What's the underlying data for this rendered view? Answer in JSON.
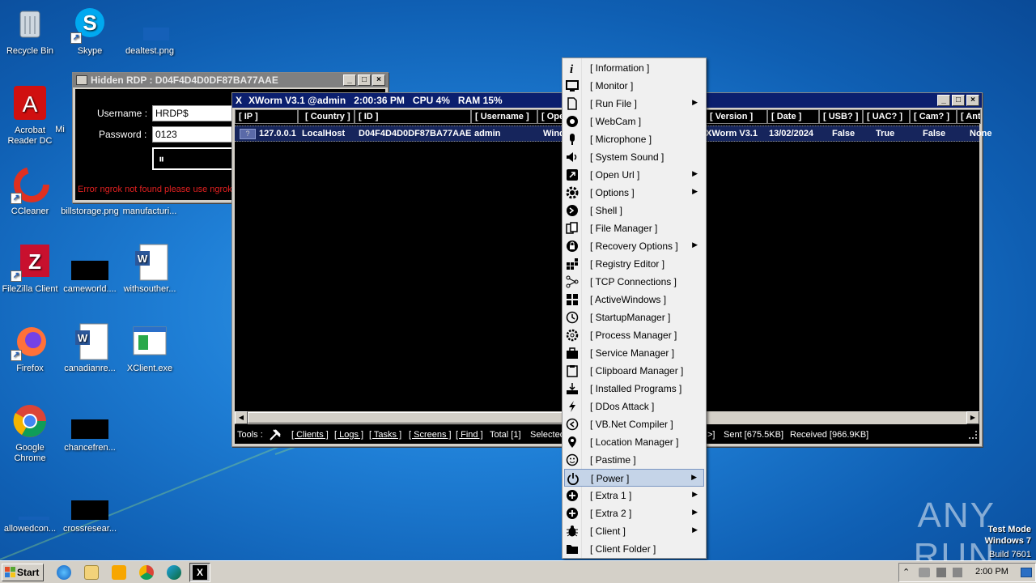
{
  "desktop_icons": [
    {
      "name": "recycle-bin-icon",
      "label": "Recycle Bin"
    },
    {
      "name": "skype-icon",
      "label": "Skype"
    },
    {
      "name": "dealtest-icon",
      "label": "dealtest.png"
    },
    {
      "name": "acrobat-icon",
      "label": "Acrobat Reader DC"
    },
    {
      "name": "mi-icon",
      "label": "Mi"
    },
    {
      "name": "ccleaner-icon",
      "label": "CCleaner"
    },
    {
      "name": "billstorage-icon",
      "label": "billstorage.png"
    },
    {
      "name": "manufacturi-icon",
      "label": "manufacturi..."
    },
    {
      "name": "filezilla-icon",
      "label": "FileZilla Client"
    },
    {
      "name": "cameworld-icon",
      "label": "cameworld...."
    },
    {
      "name": "withsouther-icon",
      "label": "withsouther..."
    },
    {
      "name": "firefox-icon",
      "label": "Firefox"
    },
    {
      "name": "canadianre-icon",
      "label": "canadianre..."
    },
    {
      "name": "xclient-icon",
      "label": "XClient.exe"
    },
    {
      "name": "chrome-icon",
      "label": "Google Chrome"
    },
    {
      "name": "chancefren-icon",
      "label": "chancefren..."
    },
    {
      "name": "allowedcon-icon",
      "label": "allowedcon..."
    },
    {
      "name": "crossresear-icon",
      "label": "crossresear..."
    }
  ],
  "rdp": {
    "title": "Hidden RDP : D04F4D4D0DF87BA77AAE",
    "username_label": "Username :",
    "username_value": "HRDP$",
    "password_label": "Password :",
    "password_value": "0123",
    "pause_symbol": "⏸",
    "error": "Error ngrok not found please use ngrok"
  },
  "xworm": {
    "title": "XWorm V3.1 @admin",
    "time": "2:00:36 PM",
    "cpu": "CPU 4%",
    "ram": "RAM 15%",
    "columns": [
      "[ IP ]",
      "[ Country ]",
      "[ ID ]",
      "[ Username ]",
      "[ Ope",
      "[ Version ]",
      "[ Date ]",
      "[ USB? ]",
      "[ UAC? ]",
      "[ Cam? ]",
      "[ Anti"
    ],
    "row": {
      "ip": "127.0.0.1",
      "country": "LocalHost",
      "id": "D04F4D4D0DF87BA77AAE",
      "username": "admin",
      "os": "Wind",
      "version": "XWorm V3.1",
      "date": "13/02/2024",
      "usb": "False",
      "uac": "True",
      "cam": "False",
      "anti": "None"
    },
    "status": {
      "tools": "Tools :",
      "clients": "[ Clients ]",
      "logs": "[ Logs ]",
      "tasks": "[ Tasks ]",
      "screens": "[ Screens ]",
      "find": "[ Find ]",
      "total": "Total [1]",
      "selected": "Selected",
      "tail": ">]",
      "sent": "Sent [675.5KB]",
      "received": "Received [966.9KB]"
    }
  },
  "menu": [
    {
      "label": "[ Information ]",
      "icon": "info-icon",
      "sub": false
    },
    {
      "label": "[ Monitor ]",
      "icon": "monitor-icon",
      "sub": false
    },
    {
      "label": "[ Run File ]",
      "icon": "file-icon",
      "sub": true
    },
    {
      "label": "[ WebCam ]",
      "icon": "webcam-icon",
      "sub": false
    },
    {
      "label": "[ Microphone ]",
      "icon": "microphone-icon",
      "sub": false
    },
    {
      "label": "[ System Sound ]",
      "icon": "speaker-icon",
      "sub": false
    },
    {
      "label": "[ Open Url ]",
      "icon": "link-icon",
      "sub": true
    },
    {
      "label": "[ Options ]",
      "icon": "gear-icon",
      "sub": true
    },
    {
      "label": "[ Shell ]",
      "icon": "shell-icon",
      "sub": false
    },
    {
      "label": "[ File Manager ]",
      "icon": "files-icon",
      "sub": false
    },
    {
      "label": "[ Recovery Options ]",
      "icon": "recovery-icon",
      "sub": true
    },
    {
      "label": "[ Registry Editor ]",
      "icon": "registry-icon",
      "sub": false
    },
    {
      "label": "[ TCP Connections ]",
      "icon": "network-icon",
      "sub": false
    },
    {
      "label": "[ ActiveWindows ]",
      "icon": "windows-icon",
      "sub": false
    },
    {
      "label": "[ StartupManager ]",
      "icon": "clock-icon",
      "sub": false
    },
    {
      "label": "[ Process Manager ]",
      "icon": "cog-icon",
      "sub": false
    },
    {
      "label": "[ Service Manager ]",
      "icon": "service-icon",
      "sub": false
    },
    {
      "label": "[ Clipboard Manager ]",
      "icon": "clipboard-icon",
      "sub": false
    },
    {
      "label": "[ Installed Programs ]",
      "icon": "download-icon",
      "sub": false
    },
    {
      "label": "[ DDos Attack ]",
      "icon": "lightning-icon",
      "sub": false
    },
    {
      "label": "[ VB.Net Compiler ]",
      "icon": "compiler-icon",
      "sub": false
    },
    {
      "label": "[ Location Manager ]",
      "icon": "location-icon",
      "sub": false
    },
    {
      "label": "[ Pastime ]",
      "icon": "smiley-icon",
      "sub": false
    },
    {
      "label": "[ Power ]",
      "icon": "power-icon",
      "sub": true,
      "highlight": true
    },
    {
      "label": "[ Extra 1 ]",
      "icon": "plus-icon",
      "sub": true
    },
    {
      "label": "[ Extra 2 ]",
      "icon": "plus-icon",
      "sub": true
    },
    {
      "label": "[ Client ]",
      "icon": "bug-icon",
      "sub": true
    },
    {
      "label": "[ Client Folder ]",
      "icon": "folder-icon",
      "sub": false
    }
  ],
  "taskbar": {
    "start": "Start",
    "clock": "2:00 PM"
  },
  "watermark": {
    "brand": "ANY RUN",
    "line1": "Test Mode",
    "line2": "Windows 7",
    "line3": "Build 7601"
  },
  "colors": {
    "xworm_title": "#0b1f6e",
    "rdp_title": "#808080",
    "menu_highlight": "#c5d4e8"
  }
}
